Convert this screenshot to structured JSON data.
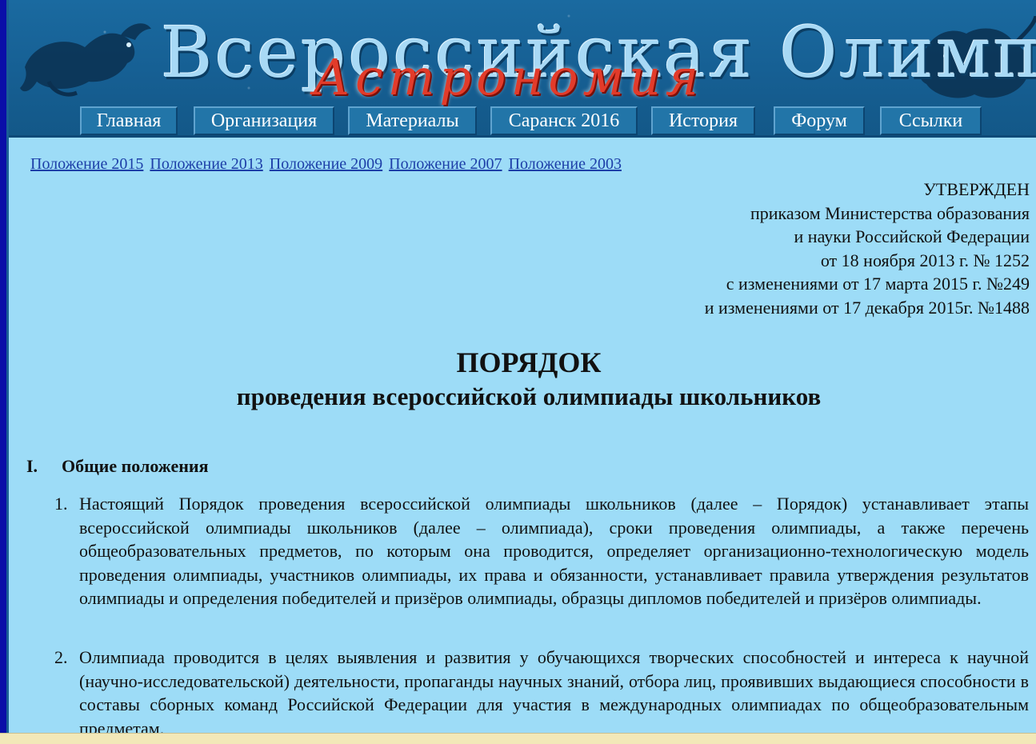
{
  "banner": {
    "title": "Всероссийская Олимпиада",
    "subtitle": "Астрономия",
    "left_image": "sea-monster-icon",
    "right_image": "lion-icon"
  },
  "nav": {
    "items": [
      {
        "label": "Главная"
      },
      {
        "label": "Организация"
      },
      {
        "label": "Материалы"
      },
      {
        "label": "Саранск 2016"
      },
      {
        "label": "История"
      },
      {
        "label": "Форум"
      },
      {
        "label": "Ссылки"
      }
    ]
  },
  "doc_links": [
    {
      "label": "Положение 2015"
    },
    {
      "label": "Положение 2013"
    },
    {
      "label": "Положение 2009"
    },
    {
      "label": "Положение 2007"
    },
    {
      "label": "Положение 2003"
    }
  ],
  "approval": {
    "lines": [
      "УТВЕРЖДЕН",
      "приказом Министерства образования",
      "и науки Российской Федерации",
      "от 18 ноября 2013 г. № 1252",
      "с изменениями от 17 марта 2015 г. №249",
      "и изменениями от 17 декабря 2015г. №1488"
    ]
  },
  "document": {
    "title": "ПОРЯДОК",
    "subtitle": "проведения всероссийской олимпиады школьников",
    "section_number": "I.",
    "section_title": "Общие положения",
    "items": [
      {
        "num": "1.",
        "text": "Настоящий Порядок проведения всероссийской олимпиады школьников (далее – Порядок) устанавливает этапы всероссийской олимпиады школьников (далее – олимпиада), сроки проведения олимпиады, а также перечень общеобразовательных предметов, по которым она проводится, определяет организационно-технологическую модель проведения олимпиады, участников олимпиады, их права и обязанности, устанавливает правила утверждения результатов олимпиады и определения победителей и призёров олимпиады, образцы дипломов победителей и призёров олимпиады."
      },
      {
        "num": "2.",
        "text": "Олимпиада проводится в целях выявления и развития у обучающихся творческих способностей и интереса к научной (научно-исследовательской) деятельности, пропаганды научных знаний, отбора лиц, проявивших выдающиеся способности в составы сборных команд Российской Федерации для участия в международных олимпиадах по общеобразовательным предметам."
      }
    ]
  },
  "colors": {
    "page_border": "#0a0ea8",
    "content_bg": "#9ddcf7",
    "banner_bg": "#165f93",
    "logo_red": "#e23b2a",
    "link": "#1d3fa8"
  }
}
